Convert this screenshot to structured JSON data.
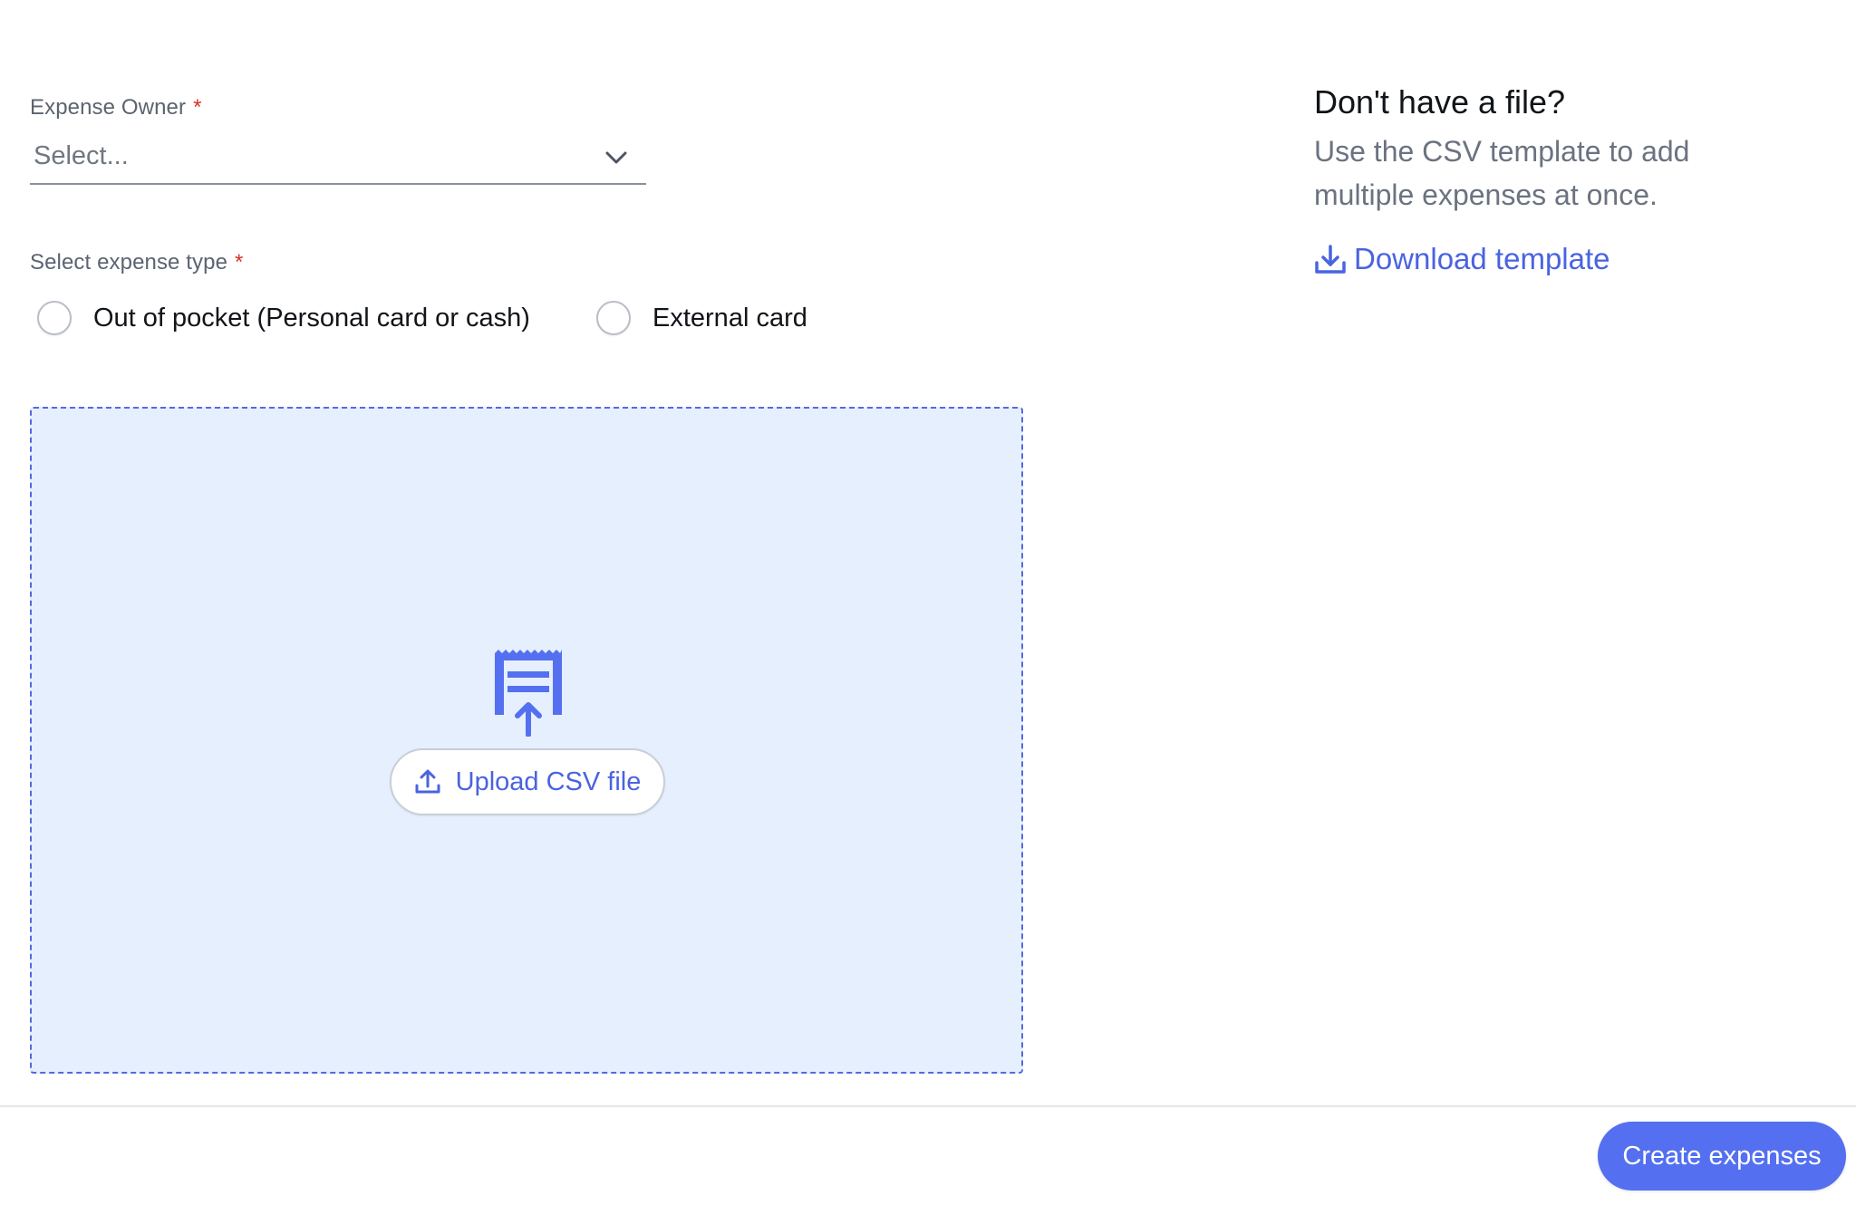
{
  "form": {
    "owner_label": "Expense Owner",
    "owner_required": "*",
    "owner_placeholder": "Select...",
    "type_label": "Select expense type",
    "type_required": "*",
    "type_options": [
      {
        "label": "Out of pocket (Personal card or cash)",
        "selected": false
      },
      {
        "label": "External card",
        "selected": false
      }
    ]
  },
  "dropzone": {
    "icon": "receipt-upload-icon",
    "upload_button_icon": "upload-icon",
    "upload_button_label": "Upload CSV file"
  },
  "help": {
    "title": "Don't have a file?",
    "description": "Use the CSV template to add multiple expenses at once.",
    "download_icon": "download-icon",
    "download_label": "Download template"
  },
  "footer": {
    "primary_button_label": "Create expenses"
  },
  "colors": {
    "accent": "#5470f0",
    "link": "#4a63e0",
    "required": "#d93025",
    "dropzone_bg": "#e6effd"
  }
}
